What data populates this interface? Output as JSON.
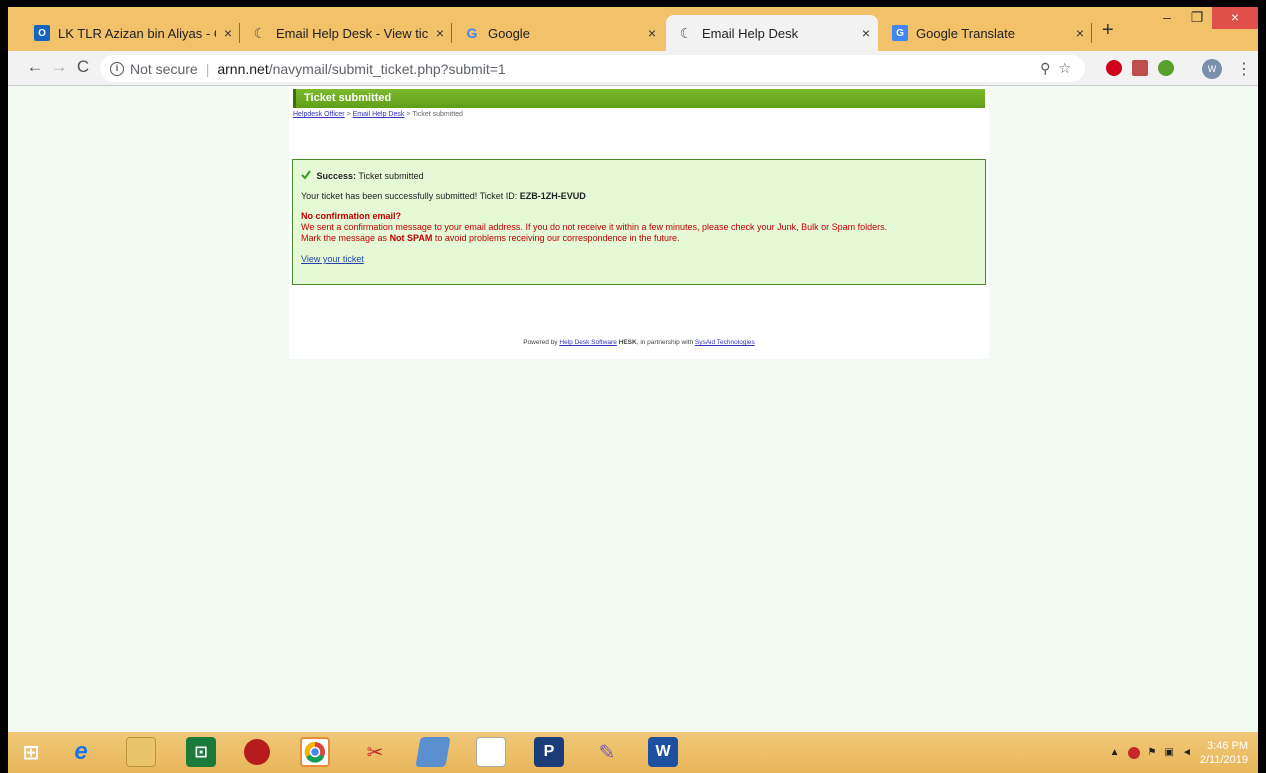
{
  "tabs": [
    {
      "label": "LK TLR Azizan bin Aliyas - Outlo",
      "icon": "outlook-icon",
      "close": "×"
    },
    {
      "label": "Email Help Desk - View ticket",
      "icon": "hesk-icon",
      "close": "×"
    },
    {
      "label": "Google",
      "icon": "google-icon",
      "close": "×"
    },
    {
      "label": "Email Help Desk",
      "icon": "hesk-icon",
      "close": "×"
    },
    {
      "label": "Google Translate",
      "icon": "translate-icon",
      "close": "×"
    }
  ],
  "new_tab": "+",
  "window": {
    "minimize": "–",
    "restore": "❐",
    "close": "×"
  },
  "nav": {
    "back": "←",
    "forward": "→",
    "reload": "C"
  },
  "address": {
    "security_text": "Not secure",
    "domain": "arnn.net",
    "path": "/navymail/submit_ticket.php?submit=1"
  },
  "toolbar_icons": {
    "zoom": "⚲",
    "star": "☆",
    "menu": "⋮",
    "avatar": "W"
  },
  "page": {
    "header_title": "Ticket submitted",
    "breadcrumb": {
      "item1": "Helpdesk Officer",
      "sep1": ">",
      "item2": "Email Help Desk",
      "sep2": ">",
      "current": "Ticket submitted"
    },
    "notice": {
      "success_label": "Success:",
      "success_text": "Ticket submitted",
      "ticket_prefix": "Your ticket has been successfully submitted! Ticket ID:",
      "ticket_id": "EZB-1ZH-EVUD",
      "no_confirm_title": "No confirmation email?",
      "line1": "We sent a confirmation message to your email address. If you do not receive it within a few minutes, please check your Junk, Bulk or Spam folders.",
      "line2_prefix": "Mark the message as",
      "line2_bold": "Not SPAM",
      "line2_suffix": "to avoid problems receiving our correspondence in the future.",
      "view_link": "View your ticket"
    },
    "footer": {
      "prefix": "Powered by",
      "link1": "Help Desk Software",
      "brand": "HESK",
      "middle": ", in partnership with",
      "link2": "SysAid Technologies"
    }
  },
  "taskbar": {
    "time": "3:46 PM",
    "date": "2/11/2019"
  }
}
